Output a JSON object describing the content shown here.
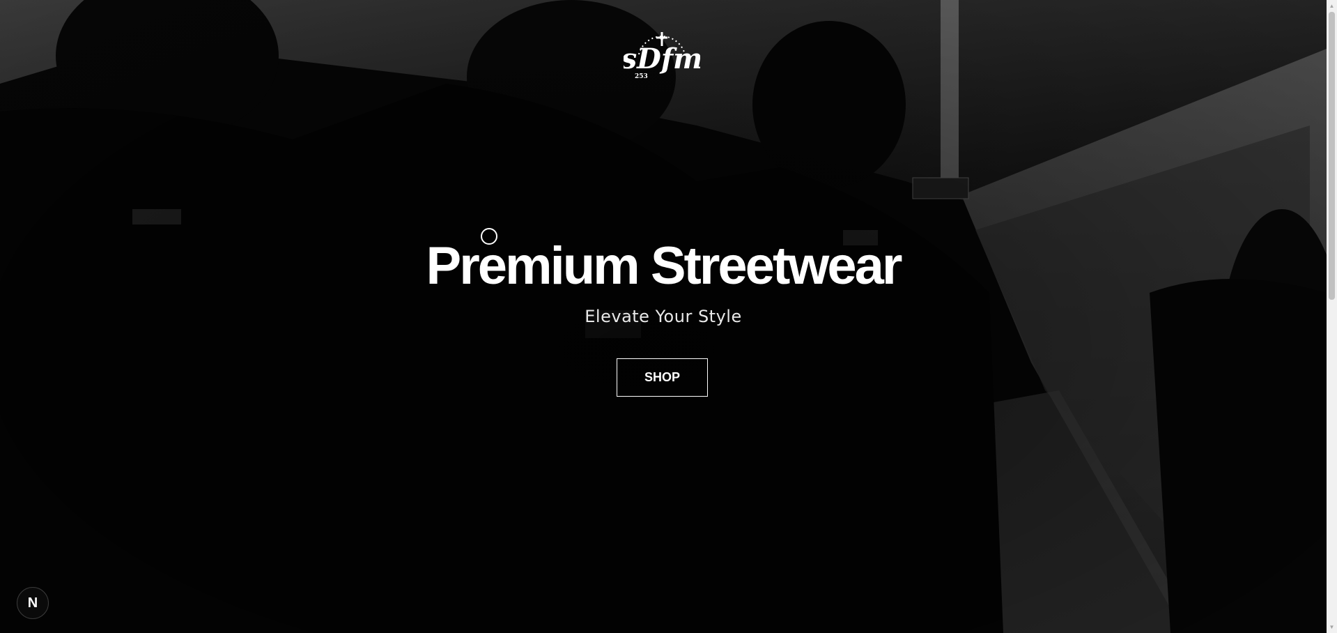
{
  "brand": {
    "logo_text": "sDfm",
    "logo_small": "253"
  },
  "hero": {
    "title": "Premium Streetwear",
    "subtitle": "Elevate Your Style",
    "cta_label": "SHOP"
  },
  "dev_badge": {
    "label": "N"
  },
  "colors": {
    "background": "#000000",
    "text": "#ffffff",
    "button_border": "#ffffff"
  },
  "scrollbar": {
    "up_glyph": "▲",
    "down_glyph": "▼"
  }
}
